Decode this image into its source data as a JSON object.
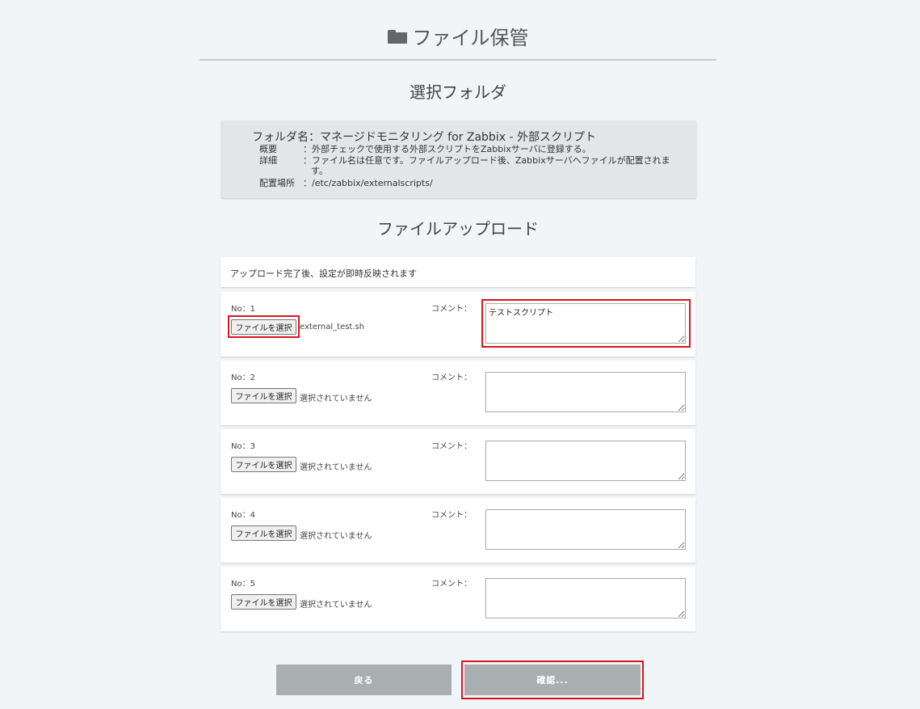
{
  "header": {
    "title": "ファイル保管",
    "icon": "folder-icon"
  },
  "selected_section": {
    "heading": "選択フォルダ",
    "folder_name": "フォルダ名：マネージドモニタリング for Zabbix - 外部スクリプト",
    "summary_key": "概要",
    "summary_value": "：外部チェックで使用する外部スクリプトをZabbixサーバに登録する。",
    "detail_key": "詳細",
    "detail_value": "：ファイル名は任意です。ファイルアップロード後、Zabbixサーバへファイルが配置されま",
    "detail_value_cont": "す。",
    "location_key": "配置場所",
    "location_value": "：/etc/zabbix/externalscripts/"
  },
  "upload_section": {
    "heading": "ファイルアップロード",
    "notice": "アップロード完了後、設定が即時反映されます",
    "file_button_label": "ファイルを選択",
    "comment_label": "コメント：",
    "rows": [
      {
        "no": "No：1",
        "file_status": "external_test.sh",
        "comment": "テストスクリプト"
      },
      {
        "no": "No：2",
        "file_status": "選択されていません",
        "comment": ""
      },
      {
        "no": "No：3",
        "file_status": "選択されていません",
        "comment": ""
      },
      {
        "no": "No：4",
        "file_status": "選択されていません",
        "comment": ""
      },
      {
        "no": "No：5",
        "file_status": "選択されていません",
        "comment": ""
      }
    ]
  },
  "actions": {
    "back_label": "戻る",
    "confirm_label": "確認..."
  },
  "colors": {
    "background": "#f1f5f8",
    "button": "#a9aeb0",
    "highlight": "#d9161e"
  }
}
